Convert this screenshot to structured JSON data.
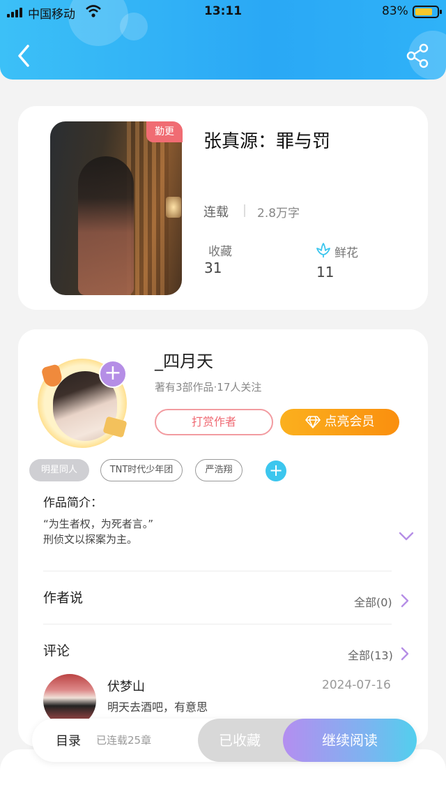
{
  "status_bar": {
    "carrier": "中国移动",
    "time": "13:11",
    "battery": "83%",
    "battery_level": 0.83
  },
  "header": {
    "back_icon": "chevron-left-icon",
    "share_icon": "share-icon",
    "background": "#2ab0f6"
  },
  "book": {
    "badge": "勤更",
    "title": "张真源：罪与罚",
    "status": "连载",
    "word_count": "2.8万字",
    "favorites_label": "收藏",
    "favorites_count": "31",
    "flowers_label": "鲜花",
    "flowers_count": "11"
  },
  "author": {
    "name": "_四月天",
    "meta": "著有3部作品·17人关注",
    "tip_button": "打赏作者",
    "vip_button": "点亮会员",
    "follow_plus": "+"
  },
  "tags": [
    "明星同人",
    "TNT时代少年团",
    "严浩翔"
  ],
  "tag_add": "+",
  "intro": {
    "title": "作品简介：",
    "line1": "“为生者权，为死者言。”",
    "line2": "刑侦文以探案为主。"
  },
  "author_says": {
    "title": "作者说",
    "more": "全部(0)"
  },
  "comments": {
    "title": "评论",
    "more": "全部(13)",
    "items": [
      {
        "name": "伏梦山",
        "date": "2024-07-16",
        "text": "明天去酒吧，有意思"
      }
    ]
  },
  "bottom_bar": {
    "toc": "目录",
    "chapters": "已连载25章",
    "collected": "已收藏",
    "continue": "继续阅读"
  },
  "colors": {
    "accent_blue": "#2ab0f6",
    "accent_purple": "#b58ee6",
    "vip_orange": "#fa9a14",
    "tip_red": "#ef6a73"
  }
}
